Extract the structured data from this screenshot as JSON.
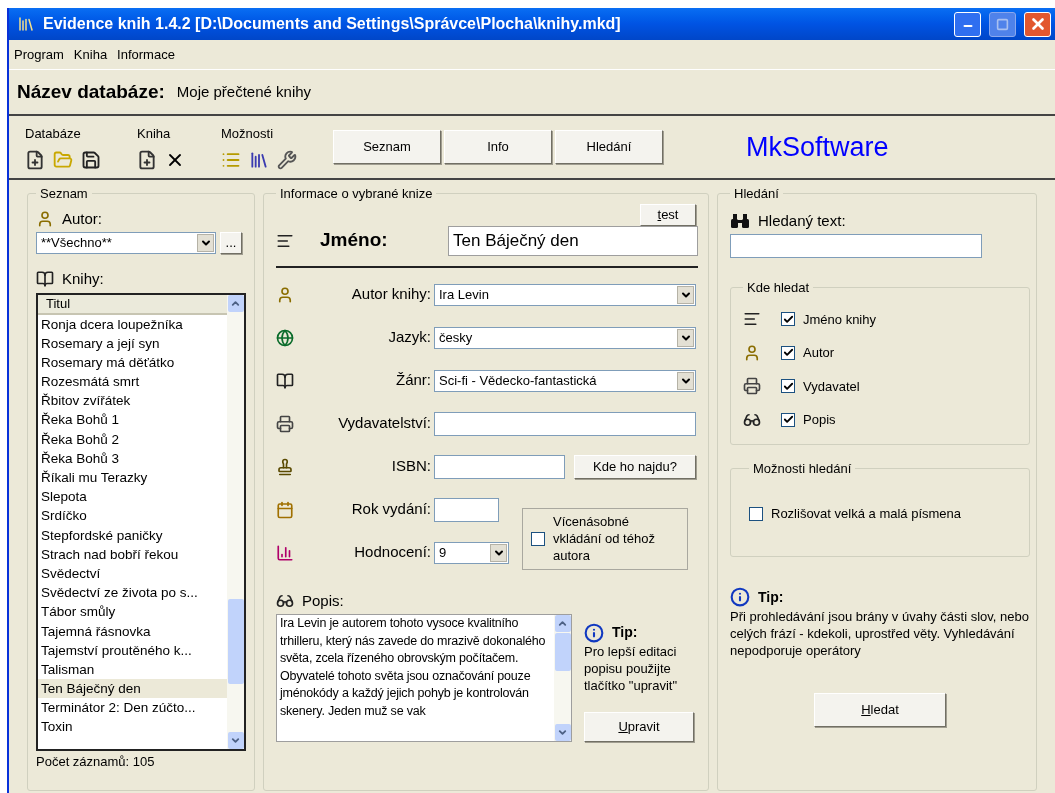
{
  "window": {
    "title": "Evidence knih 1.4.2  [D:\\Documents and Settings\\Správce\\Plocha\\knihy.mkd]"
  },
  "menu": [
    "Program",
    "Kniha",
    "Informace"
  ],
  "database": {
    "label": "Název databáze:",
    "value": "Moje přečtené knihy"
  },
  "toolbar": {
    "groups": [
      {
        "label": "Databáze"
      },
      {
        "label": "Kniha"
      },
      {
        "label": "Možnosti"
      }
    ],
    "buttons": [
      "Seznam",
      "Info",
      "Hledání"
    ],
    "brand": "MkSoftware"
  },
  "list_panel": {
    "title": "Seznam",
    "author_label": "Autor:",
    "author_value": "**Všechno**",
    "more_button": "...",
    "books_label": "Knihy:",
    "column": "Titul",
    "rows": [
      {
        "title": "Ronja dcera loupežníka",
        "selected": false
      },
      {
        "title": "Rosemary a její syn",
        "selected": false
      },
      {
        "title": "Rosemary má děťátko",
        "selected": false
      },
      {
        "title": "Rozesmátá smrt",
        "selected": false
      },
      {
        "title": "Řbitov zvířátek",
        "selected": false
      },
      {
        "title": "Řeka Bohů 1",
        "selected": false
      },
      {
        "title": "Řeka Bohů 2",
        "selected": false
      },
      {
        "title": "Řeka Bohů 3",
        "selected": false
      },
      {
        "title": "Říkali mu Terazky",
        "selected": false
      },
      {
        "title": "Slepota",
        "selected": false
      },
      {
        "title": "Srdíčko",
        "selected": false
      },
      {
        "title": "Stepfordské paničky",
        "selected": false
      },
      {
        "title": "Strach nad bobří řekou",
        "selected": false
      },
      {
        "title": "Svědectví",
        "selected": false
      },
      {
        "title": "Svědectví ze života po s...",
        "selected": false
      },
      {
        "title": "Tábor smůly",
        "selected": false
      },
      {
        "title": "Tajemná řásnovka",
        "selected": false
      },
      {
        "title": "Tajemství proutěného k...",
        "selected": false
      },
      {
        "title": "Talisman",
        "selected": false
      },
      {
        "title": "Ten Báječný den",
        "selected": true
      },
      {
        "title": "Terminátor 2: Den zúčto...",
        "selected": false
      },
      {
        "title": "Toxin",
        "selected": false
      }
    ],
    "count": "Počet záznamů: 105"
  },
  "detail_panel": {
    "title": "Informace o vybrané knize",
    "test_button": "test",
    "name_label": "Jméno:",
    "name_value": "Ten Báječný den",
    "fields": [
      {
        "kind": "combo",
        "label": "Autor knihy:",
        "value": "Ira Levin"
      },
      {
        "kind": "combo",
        "label": "Jazyk:",
        "value": "česky"
      },
      {
        "kind": "combo",
        "label": "Žánr:",
        "value": "Sci-fi  -  Vědecko-fantastická"
      },
      {
        "kind": "text",
        "label": "Vydavatelství:"
      },
      {
        "kind": "isbn",
        "label": "ISBN:",
        "button": "Kde ho najdu?"
      },
      {
        "kind": "year",
        "label": "Rok vydání:"
      },
      {
        "kind": "rating",
        "label": "Hodnocení:",
        "value": "9"
      }
    ],
    "multi": {
      "label": "Vícenásobné vkládání od téhož autora",
      "checked": false
    },
    "description_label": "Popis:",
    "description": "Ira Levin je autorem tohoto vysoce kvalitního trhilleru, který nás zavede do mrazivě dokonalého světa, zcela řízeného obrovským počítačem. Obyvatelé tohoto světa jsou označování pouze jménokódy a každý jejich pohyb je kontrolován skenery. Jeden muž se vak",
    "tip_title": "Tip:",
    "tip_text": "Pro lepší editaci popisu použijte tlačítko \"upravit\"",
    "edit_button": "Upravit"
  },
  "search_panel": {
    "title": "Hledání",
    "search_label": "Hledaný text:",
    "where_title": "Kde hledat",
    "where": [
      {
        "label": "Jméno knihy",
        "checked": true
      },
      {
        "label": "Autor",
        "checked": true
      },
      {
        "label": "Vydavatel",
        "checked": true
      },
      {
        "label": "Popis",
        "checked": true
      }
    ],
    "options_title": "Možnosti hledání",
    "case_label": "Rozlišovat velká a malá písmena",
    "case_checked": false,
    "tip_title": "Tip:",
    "tip_text": "Při prohledávání jsou brány v úvahy části slov, nebo celých frází - kdekoli, uprostřed věty. Vyhledávání nepodporuje operátory",
    "search_button": "Hledat"
  }
}
